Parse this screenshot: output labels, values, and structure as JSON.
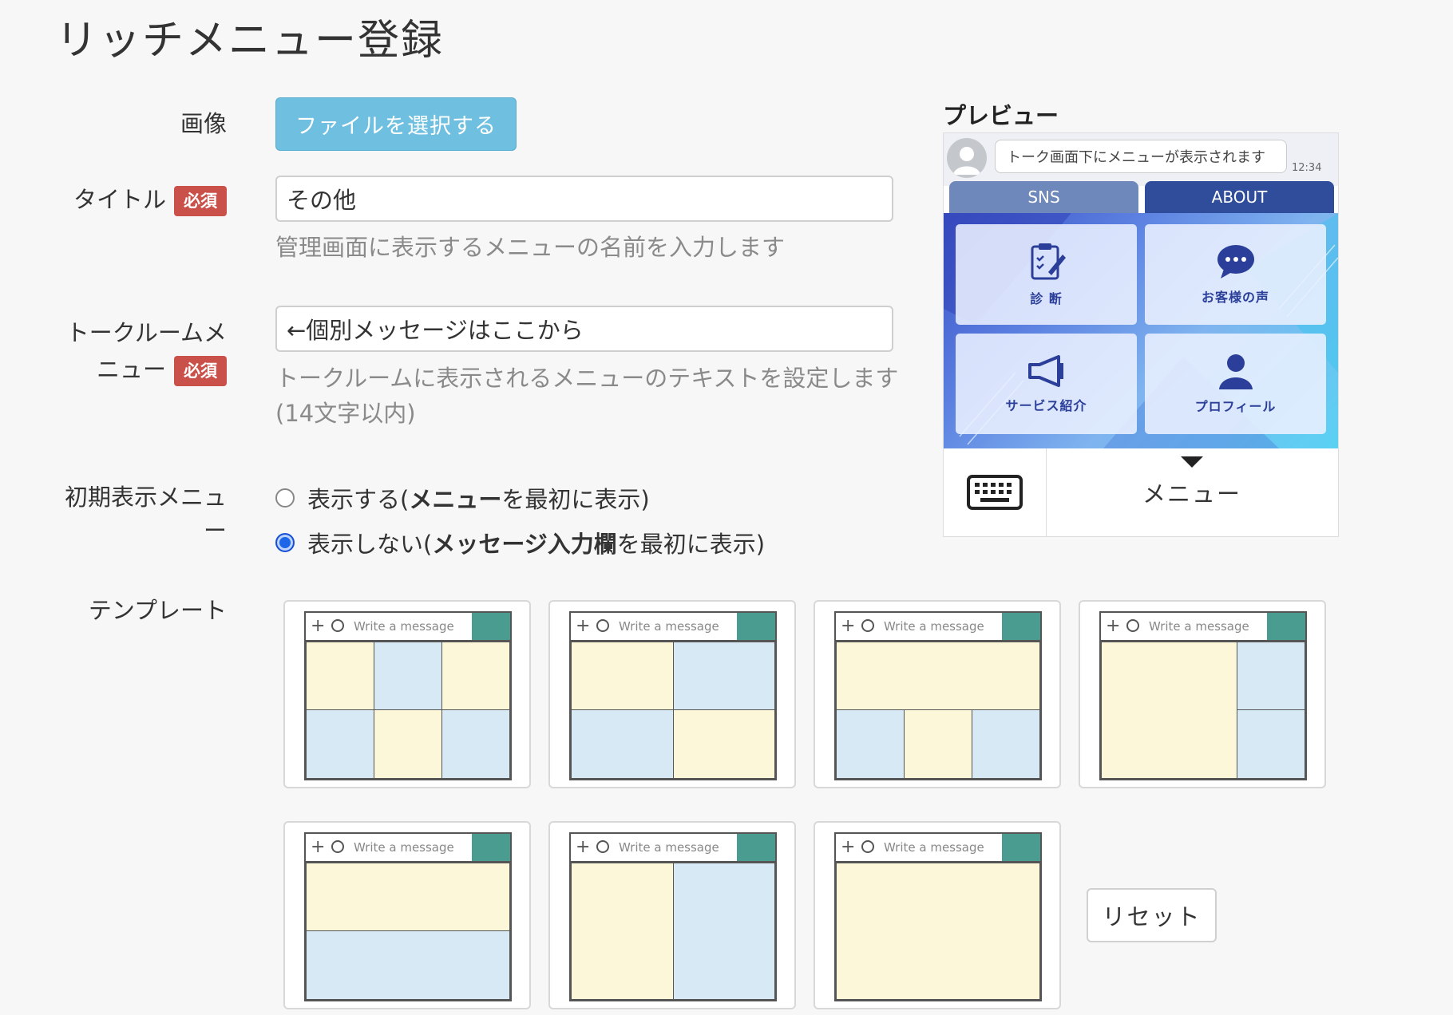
{
  "page": {
    "title": "リッチメニュー登録"
  },
  "form": {
    "image": {
      "label": "画像",
      "button": "ファイルを選択する"
    },
    "title": {
      "label": "タイトル",
      "required": "必須",
      "value": "その他",
      "help": "管理画面に表示するメニューの名前を入力します"
    },
    "talkroom": {
      "label_line1": "トークルームメ",
      "label_line2": "ニュー",
      "required": "必須",
      "value": "←個別メッセージはここから",
      "help": "トークルームに表示されるメニューのテキストを設定します(14文字以内)"
    },
    "initial": {
      "label_line1": "初期表示メニュ",
      "label_line2": "ー",
      "options": [
        {
          "prefix": "表示する(",
          "strong": "メニュー",
          "suffix": "を最初に表示)",
          "selected": false
        },
        {
          "prefix": "表示しない(",
          "strong": "メッセージ入力欄",
          "suffix": "を最初に表示)",
          "selected": true
        }
      ]
    },
    "template": {
      "label": "テンプレート",
      "placeholder": "Write a message",
      "reset": "リセット"
    }
  },
  "preview": {
    "title": "プレビュー",
    "bubble": "トーク画面下にメニューが表示されます",
    "time": "12:34",
    "tabs": [
      "SNS",
      "ABOUT"
    ],
    "cells": [
      "診 断",
      "お客様の声",
      "サービス紹介",
      "プロフィール"
    ],
    "menu_label": "メニュー",
    "colors": {
      "tab_inactive": "#6f88bb",
      "tab_active": "#2f4d9a",
      "accent_send": "#4a9c90",
      "file_button": "#6ebfe0",
      "required_badge": "#c9514a"
    }
  }
}
